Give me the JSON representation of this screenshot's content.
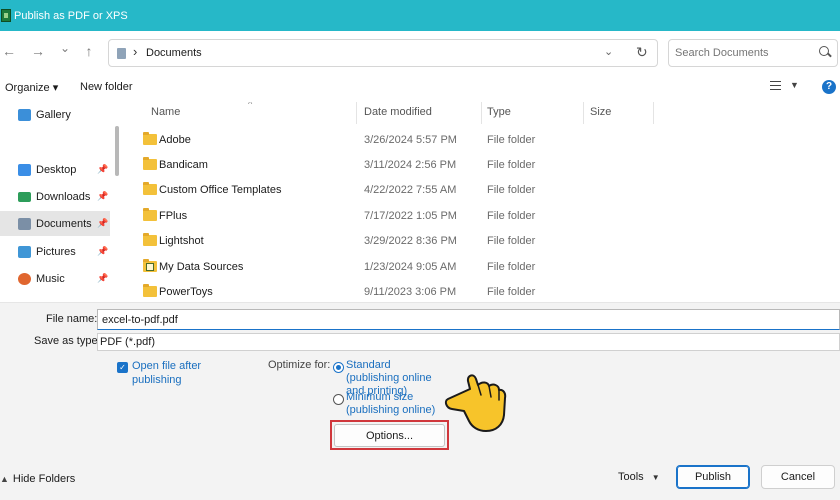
{
  "window": {
    "title": "Publish as PDF or XPS"
  },
  "nav": {
    "back": "←",
    "forward": "→",
    "recent": "⌄",
    "up": "↑",
    "path": "Documents",
    "path_sep": "›",
    "search_placeholder": "Search Documents"
  },
  "toolbar": {
    "organize": "Organize ▾",
    "new_folder": "New folder"
  },
  "sidebar": {
    "items": [
      {
        "label": "Gallery",
        "icon": "gallery-icon",
        "color": "#3b8fd9"
      },
      {
        "label": "Desktop",
        "icon": "desktop-icon",
        "color": "#3a8ee6"
      },
      {
        "label": "Downloads",
        "icon": "download-icon",
        "color": "#2d9d5a"
      },
      {
        "label": "Documents",
        "icon": "documents-icon",
        "color": "#7b8fa6"
      },
      {
        "label": "Pictures",
        "icon": "pictures-icon",
        "color": "#3f96d6"
      },
      {
        "label": "Music",
        "icon": "music-icon",
        "color": "#e0662f"
      }
    ]
  },
  "columns": {
    "name": "Name",
    "date": "Date modified",
    "type": "Type",
    "size": "Size"
  },
  "files": [
    {
      "name": "Adobe",
      "date": "3/26/2024 5:57 PM",
      "type": "File folder"
    },
    {
      "name": "Bandicam",
      "date": "3/11/2024 2:56 PM",
      "type": "File folder"
    },
    {
      "name": "Custom Office Templates",
      "date": "4/22/2022 7:55 AM",
      "type": "File folder"
    },
    {
      "name": "FPlus",
      "date": "7/17/2022 1:05 PM",
      "type": "File folder"
    },
    {
      "name": "Lightshot",
      "date": "3/29/2022 8:36 PM",
      "type": "File folder"
    },
    {
      "name": "My Data Sources",
      "date": "1/23/2024 9:05 AM",
      "type": "File folder"
    },
    {
      "name": "PowerToys",
      "date": "9/11/2023 3:06 PM",
      "type": "File folder"
    }
  ],
  "form": {
    "file_name_label": "File name:",
    "file_name_value": "excel-to-pdf.pdf",
    "save_type_label": "Save as type:",
    "save_type_value": "PDF (*.pdf)",
    "open_after": "Open file after publishing",
    "optimize_label": "Optimize for:",
    "standard": "Standard (publishing online and printing)",
    "minimum": "Minimum size (publishing online)",
    "options": "Options..."
  },
  "footer": {
    "hide_folders": "Hide Folders",
    "tools": "Tools",
    "publish": "Publish",
    "cancel": "Cancel"
  },
  "colors": {
    "titlebar": "#26b8c8",
    "accent": "#1a73c9",
    "highlight": "#d0373c",
    "folder": "#f3c13a"
  }
}
